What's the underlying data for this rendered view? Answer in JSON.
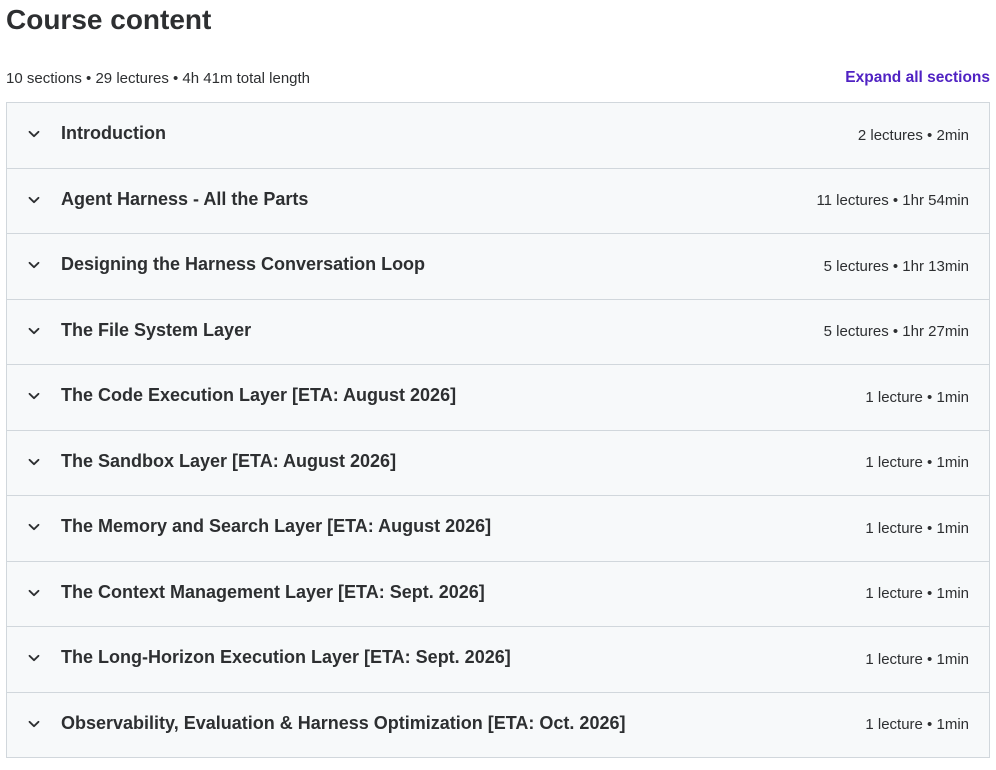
{
  "header": {
    "title": "Course content",
    "summary": "10 sections • 29 lectures • 4h 41m total length",
    "expand_all_label": "Expand all sections"
  },
  "sections": [
    {
      "title": "Introduction",
      "meta": "2 lectures • 2min",
      "icon": "chevron-down-icon"
    },
    {
      "title": "Agent Harness - All the Parts",
      "meta": "11 lectures • 1hr 54min",
      "icon": "chevron-down-icon"
    },
    {
      "title": "Designing the Harness Conversation Loop",
      "meta": "5 lectures • 1hr 13min",
      "icon": "chevron-down-icon"
    },
    {
      "title": "The File System Layer",
      "meta": "5 lectures • 1hr 27min",
      "icon": "chevron-down-icon"
    },
    {
      "title": "The Code Execution Layer [ETA: August 2026]",
      "meta": "1 lecture • 1min",
      "icon": "chevron-down-icon"
    },
    {
      "title": "The Sandbox Layer [ETA: August 2026]",
      "meta": "1 lecture • 1min",
      "icon": "chevron-down-icon"
    },
    {
      "title": "The Memory and Search Layer [ETA: August 2026]",
      "meta": "1 lecture • 1min",
      "icon": "chevron-down-icon"
    },
    {
      "title": "The Context Management Layer [ETA: Sept. 2026]",
      "meta": "1 lecture • 1min",
      "icon": "chevron-down-icon"
    },
    {
      "title": "The Long-Horizon Execution Layer [ETA: Sept. 2026]",
      "meta": "1 lecture • 1min",
      "icon": "chevron-down-icon"
    },
    {
      "title": "Observability, Evaluation & Harness Optimization [ETA: Oct. 2026]",
      "meta": "1 lecture • 1min",
      "icon": "chevron-down-icon"
    }
  ],
  "colors": {
    "accent": "#5022c3",
    "text": "#2d2f31",
    "section_bg": "#f7f9fa",
    "border": "#d1d7dc"
  }
}
